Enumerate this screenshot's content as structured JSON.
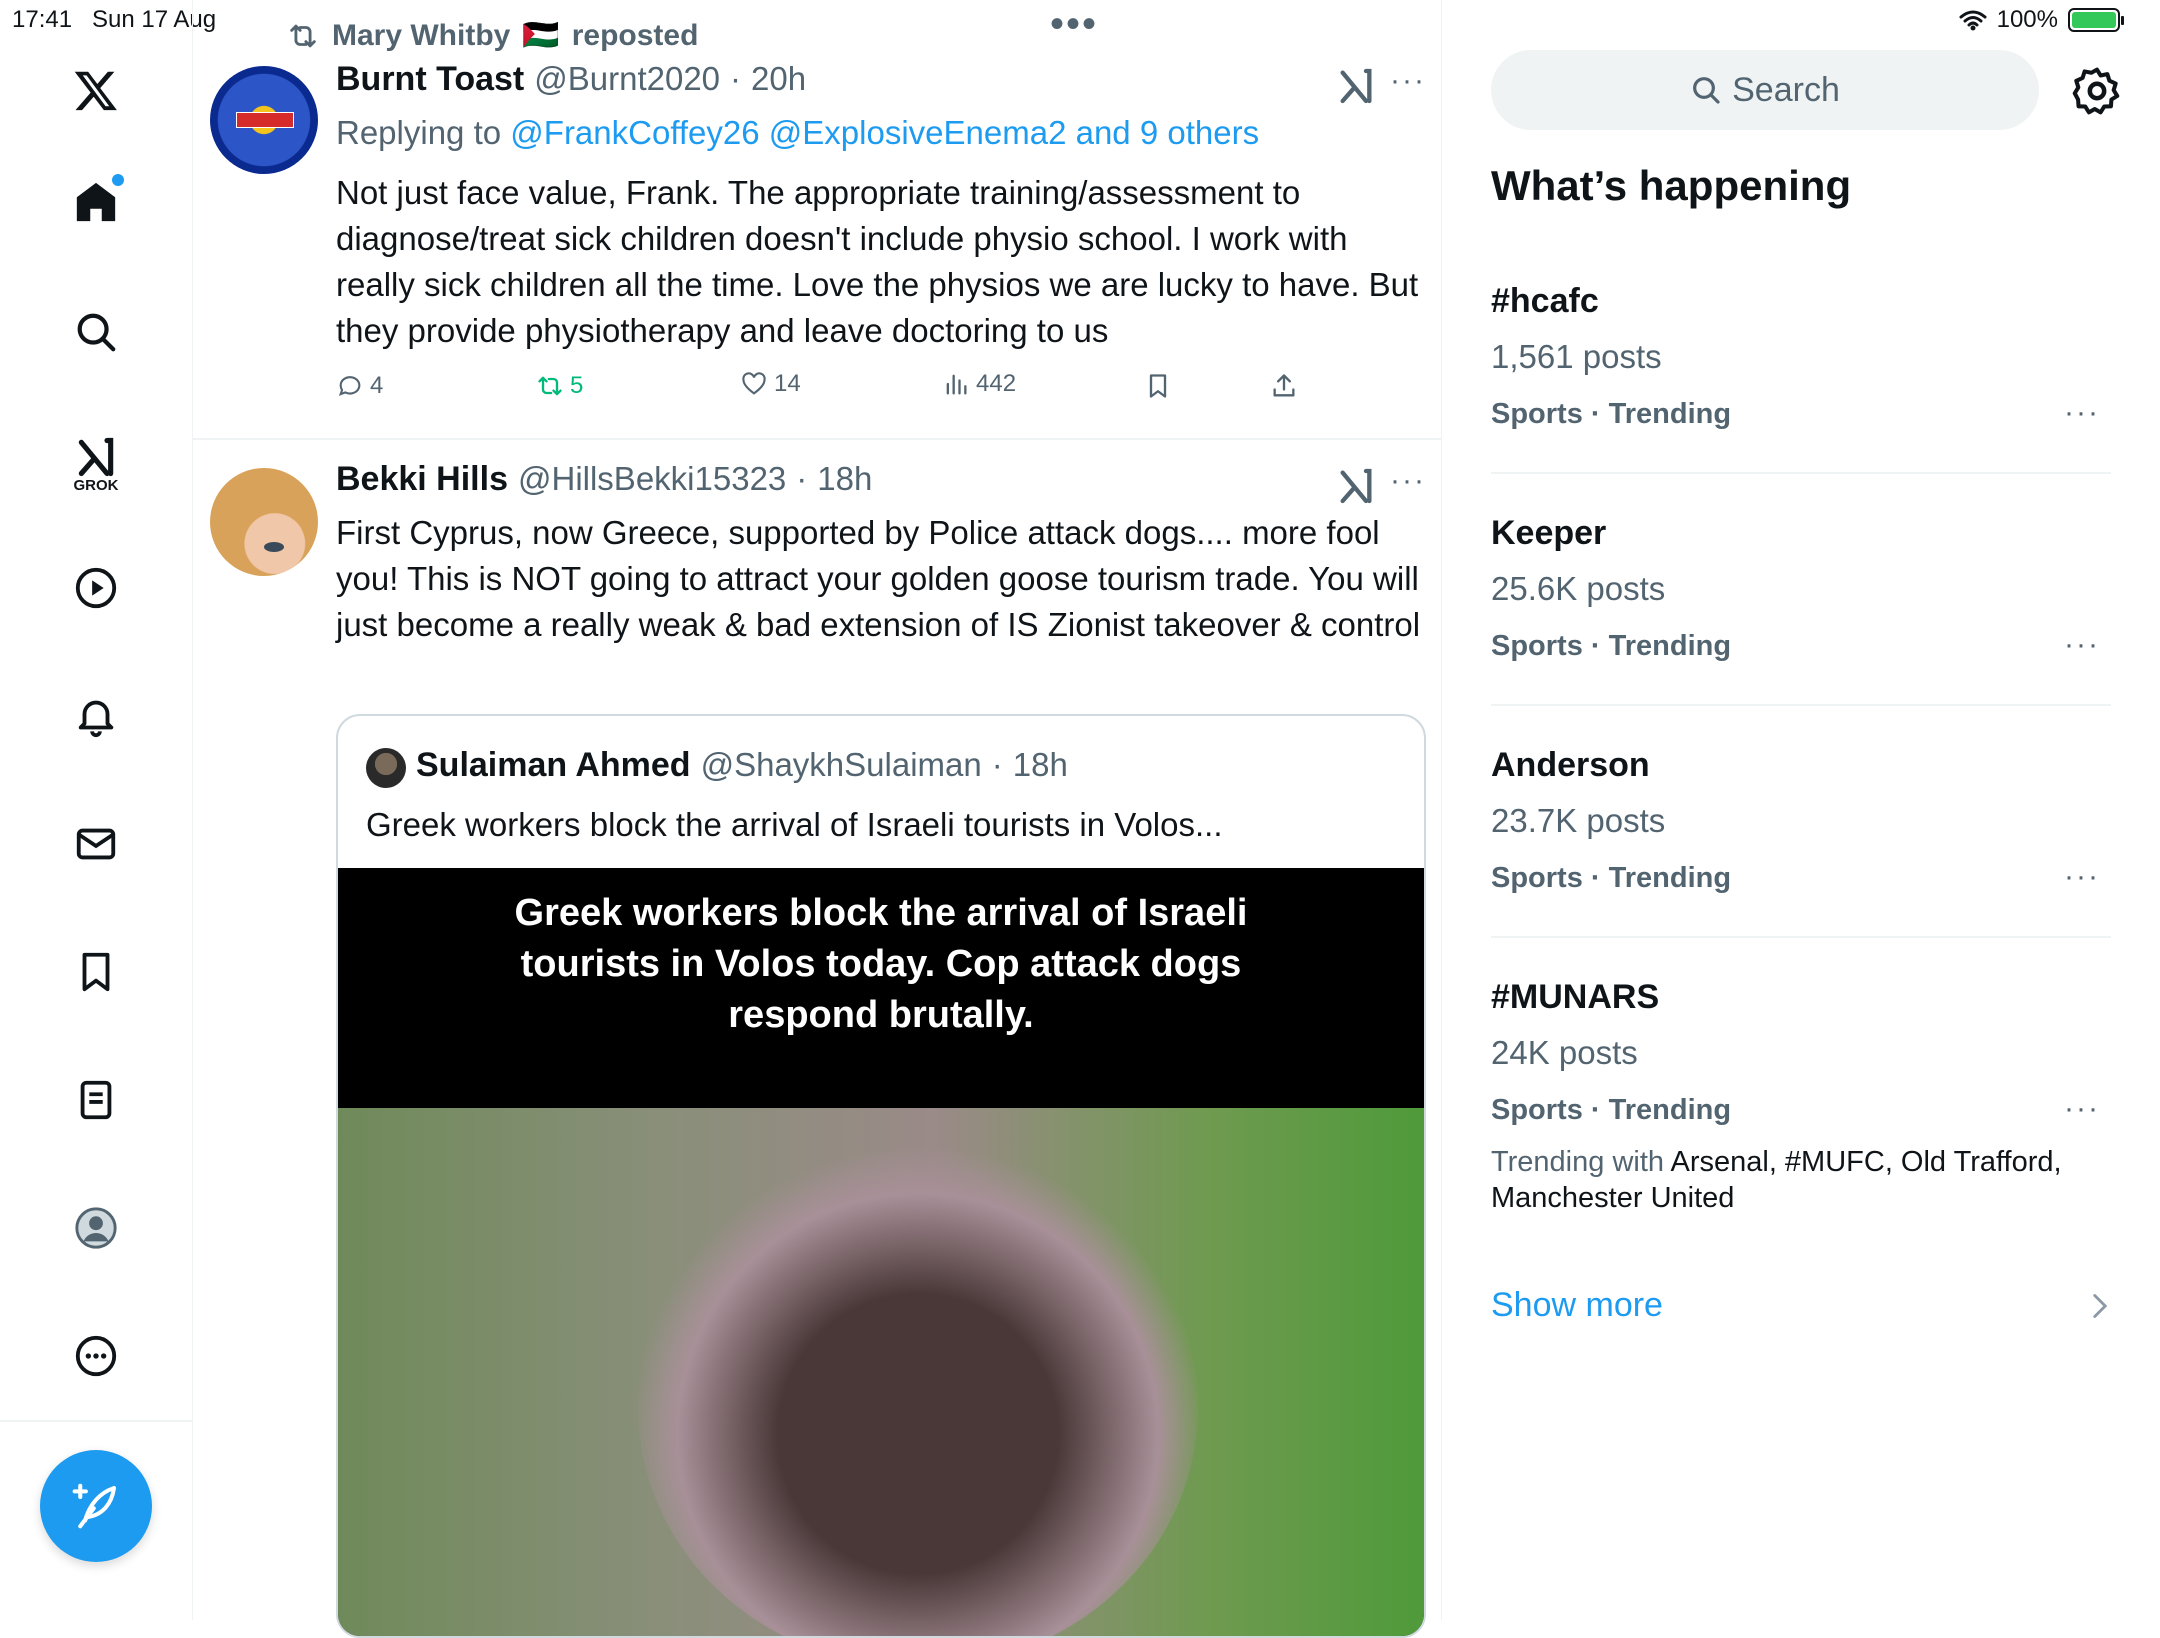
{
  "status_bar": {
    "time": "17:41",
    "date": "Sun 17 Aug",
    "battery": "100%",
    "battery_level": 1.0
  },
  "nav": {
    "items": [
      "x-logo",
      "home",
      "search",
      "grok",
      "video",
      "notifications",
      "messages",
      "bookmarks",
      "lists",
      "profile",
      "more"
    ],
    "grok_label": "GROK"
  },
  "repost_header": {
    "reposter": "Mary Whitby",
    "flag": "🇵🇸",
    "suffix": "reposted"
  },
  "posts": [
    {
      "name": "Burnt Toast",
      "handle": "@Burnt2020",
      "time": "20h",
      "replying_prefix": "Replying to",
      "replying_to": "@FrankCoffey26 @ExplosiveEnema2 and 9 others",
      "text": "Not just face value, Frank. The appropriate training/assessment to diagnose/treat sick children doesn't include physio school. I work with really sick children all the time. Love the physios we are lucky to have. But they provide physiotherapy and leave doctoring to us",
      "stats": {
        "replies": "4",
        "reposts": "5",
        "likes": "14",
        "views": "442"
      }
    },
    {
      "name": "Bekki Hills",
      "handle": "@HillsBekki15323",
      "time": "18h",
      "text": "First Cyprus, now Greece, supported by Police attack dogs.... more fool you! This is NOT going to attract your golden goose tourism trade. You will just become a really weak & bad extension of IS Zionist takeover & control",
      "quote": {
        "name": "Sulaiman Ahmed",
        "handle": "@ShaykhSulaiman",
        "time": "18h",
        "text": "Greek workers block the arrival of Israeli tourists in Volos...",
        "media_caption": "Greek workers block the arrival of Israeli tourists in Volos today.  Cop attack dogs respond brutally."
      }
    }
  ],
  "sidebar": {
    "search_placeholder": "Search",
    "heading": "What’s happening",
    "trends": [
      {
        "title": "#hcafc",
        "posts": "1,561 posts",
        "category": "Sports · Trending"
      },
      {
        "title": "Keeper",
        "posts": "25.6K posts",
        "category": "Sports · Trending"
      },
      {
        "title": "Anderson",
        "posts": "23.7K posts",
        "category": "Sports · Trending"
      },
      {
        "title": "#MUNARS",
        "posts": "24K posts",
        "category": "Sports · Trending",
        "trending_with_prefix": "Trending with",
        "trending_with": "Arsenal, #MUFC, Old Trafford, Manchester United"
      }
    ],
    "show_more": "Show more"
  },
  "colors": {
    "accent": "#1d9bf0",
    "repost_green": "#00ba7c",
    "text": "#0f1419",
    "muted": "#536471"
  }
}
